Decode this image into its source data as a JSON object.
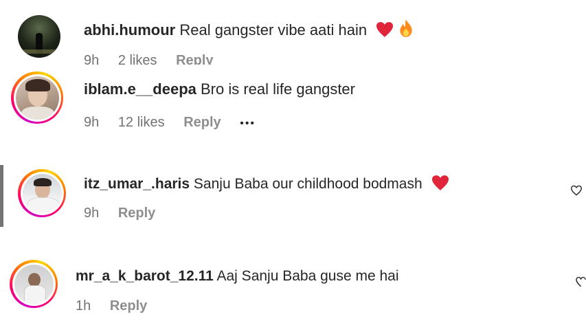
{
  "comments": [
    {
      "username": "abhi.humour",
      "text": "Real gangster vibe aati hain",
      "time": "9h",
      "likes": "2 likes",
      "reply": "Reply",
      "emojis": [
        "red-heart-icon",
        "fire-icon"
      ]
    },
    {
      "username": "iblam.e__deepa",
      "text": "Bro is real life gangster",
      "time": "9h",
      "likes": "12 likes",
      "reply": "Reply",
      "more": "•••"
    },
    {
      "username": "itz_umar_.haris",
      "text": "Sanju Baba our childhood bodmash",
      "time": "9h",
      "reply": "Reply",
      "emojis": [
        "red-heart-icon"
      ]
    },
    {
      "username": "mr_a_k_barot_12.11",
      "text": "Aaj Sanju Baba guse me hai",
      "time": "1h",
      "reply": "Reply"
    }
  ],
  "colors": {
    "text": "#262626",
    "meta": "#737373",
    "heart": "#e0245e"
  }
}
